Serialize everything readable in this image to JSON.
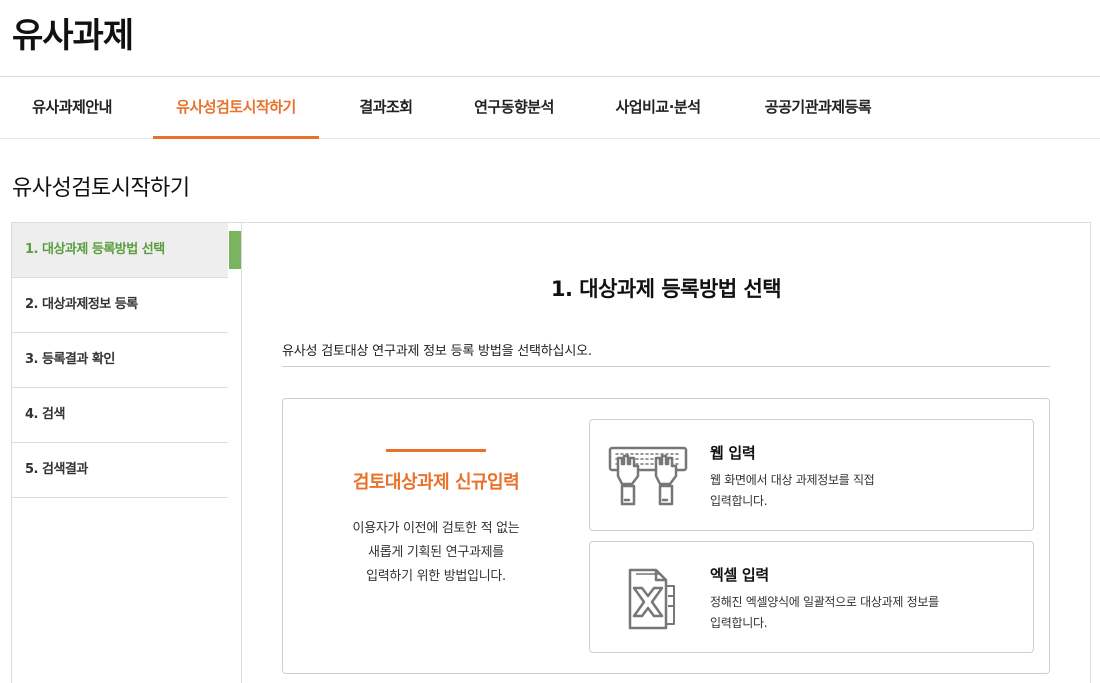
{
  "app": {
    "title": "유사과제"
  },
  "nav": {
    "tabs": [
      {
        "label": "유사과제안내"
      },
      {
        "label": "유사성검토시작하기"
      },
      {
        "label": "결과조회"
      },
      {
        "label": "연구동향분석"
      },
      {
        "label": "사업비교·분석"
      },
      {
        "label": "공공기관과제등록"
      }
    ],
    "active_tab": "유사성검토시작하기",
    "accent_color": "#e8722c"
  },
  "page": {
    "title": "유사성검토시작하기"
  },
  "sidebar": {
    "items": [
      {
        "label": "1. 대상과제 등록방법 선택"
      },
      {
        "label": "2. 대상과제정보 등록"
      },
      {
        "label": "3. 등록결과 확인"
      },
      {
        "label": "4. 검색"
      },
      {
        "label": "5. 검색결과"
      }
    ],
    "active_index": 0,
    "active_color": "#5a9e3e"
  },
  "main": {
    "heading": "1. 대상과제 등록방법 선택",
    "instruction": "유사성 검토대상 연구과제 정보 등록 방법을 선택하십시오.",
    "new_entry": {
      "title": "검토대상과제 신규입력",
      "desc_lines": [
        "이용자가 이전에 검토한 적 없는",
        "새롭게 기획된 연구과제를",
        "입력하기 위한 방법입니다."
      ]
    },
    "methods": [
      {
        "title": "웹 입력",
        "desc_lines": [
          "웹 화면에서 대상 과제정보를 직접",
          "입력합니다."
        ],
        "icon": "keyboard-typing-icon"
      },
      {
        "title": "엑셀 입력",
        "desc_lines": [
          "정해진 엑셀양식에 일괄적으로 대상과제 정보를",
          "입력합니다."
        ],
        "icon": "excel-file-icon"
      }
    ]
  }
}
